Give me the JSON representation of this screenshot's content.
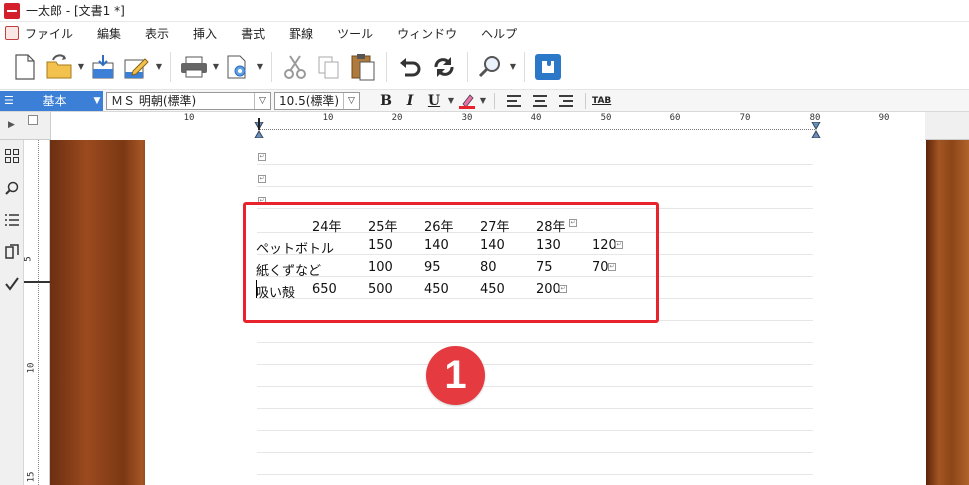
{
  "window": {
    "title": "一太郎 - [文書1 *]"
  },
  "menu": [
    "ファイル",
    "編集",
    "表示",
    "挿入",
    "書式",
    "罫線",
    "ツール",
    "ウィンドウ",
    "ヘルプ"
  ],
  "toolbar": {
    "buttons": [
      "new-document-icon",
      "open-icon",
      "save-icon",
      "edit-icon",
      "print-icon",
      "settings-icon",
      "cut-icon",
      "copy-icon",
      "paste-icon",
      "undo-icon",
      "redo-icon",
      "search-icon",
      "plugin-icon"
    ]
  },
  "format_bar": {
    "style": "基本",
    "font": "ＭＳ 明朝(標準)",
    "size": "10.5(標準)",
    "bold": "B",
    "italic": "I",
    "underline": "U",
    "tab": "TAB"
  },
  "ruler": {
    "numbers": [
      "10",
      "10",
      "20",
      "30",
      "40",
      "50",
      "60",
      "70",
      "80",
      "90"
    ]
  },
  "vertical_ruler": {
    "numbers": [
      "5",
      "10",
      "15"
    ]
  },
  "document": {
    "table": {
      "header": [
        "24年",
        "25年",
        "26年",
        "27年",
        "28年"
      ],
      "rows": [
        {
          "label": "ペットボトル",
          "values": [
            "150",
            "140",
            "140",
            "130",
            "120"
          ]
        },
        {
          "label": "紙くずなど",
          "values": [
            "100",
            "95",
            "80",
            "75",
            "70"
          ]
        },
        {
          "label": "吸い殻",
          "values": [
            "650",
            "500",
            "450",
            "450",
            "200"
          ]
        }
      ]
    }
  },
  "annotation": {
    "callout": "1",
    "color": "#e53a3f"
  }
}
